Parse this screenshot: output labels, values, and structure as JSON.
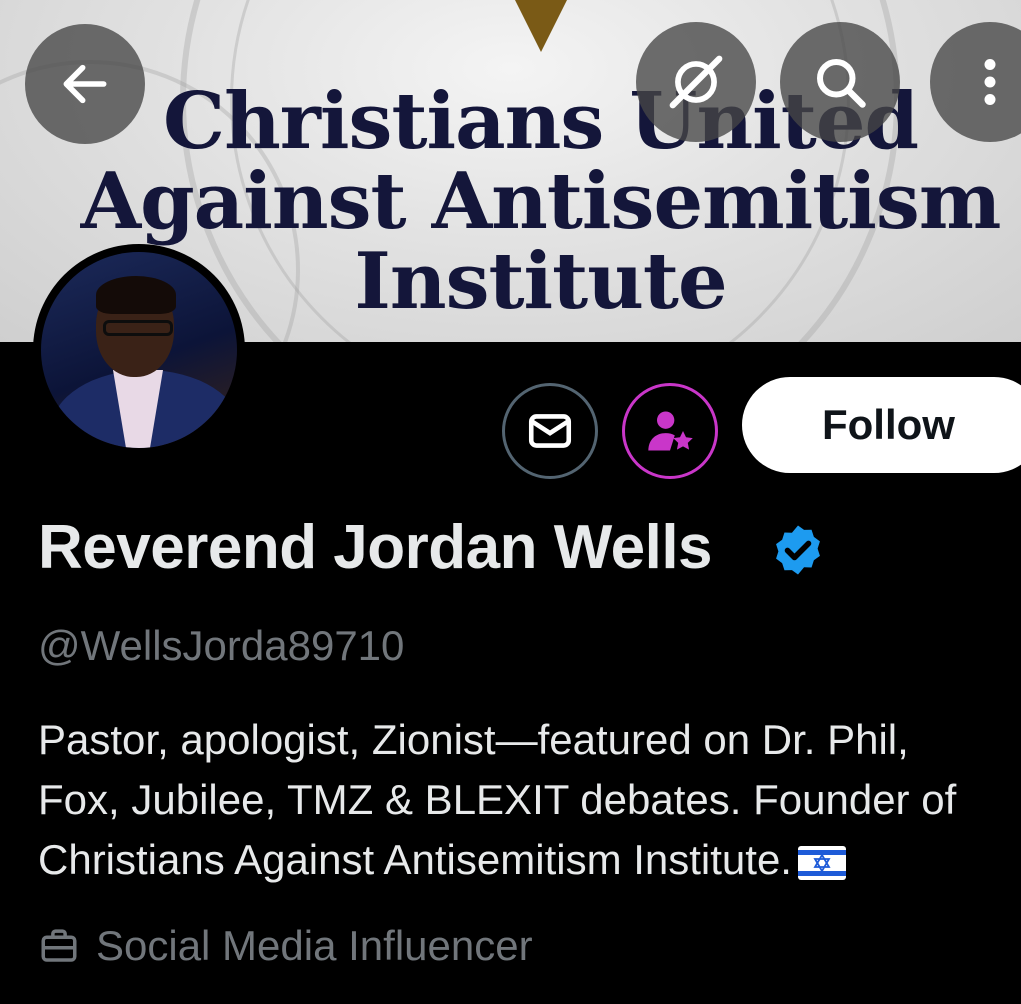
{
  "banner": {
    "title_line1": "Christians United",
    "title_line2": "Against Antisemitism",
    "title_line3": "Institute"
  },
  "header": {
    "back_icon": "arrow-left-icon",
    "grok_icon": "grok-icon",
    "search_icon": "search-icon",
    "more_icon": "more-vertical-icon"
  },
  "actions": {
    "message_icon": "envelope-icon",
    "subscribe_icon": "subscribe-icon",
    "follow_label": "Follow"
  },
  "profile": {
    "display_name": "Reverend Jordan Wells",
    "verified_icon": "verified-badge-icon",
    "handle": "@WellsJorda89710",
    "bio_line1": "Pastor, apologist, Zionist—featured on Dr. Phil,",
    "bio_line2": "Fox, Jubilee, TMZ  & BLEXIT debates. Founder of",
    "bio_line3": "Christians Against Antisemitism Institute.",
    "bio_emoji": "israel-flag",
    "category_icon": "briefcase-icon",
    "category": "Social Media Influencer"
  },
  "colors": {
    "background": "#000000",
    "text_primary": "#e7e9ea",
    "text_secondary": "#71767b",
    "verified_blue": "#1d9bf0",
    "subscribe_accent": "#c936c9",
    "banner_text": "#14163a"
  }
}
